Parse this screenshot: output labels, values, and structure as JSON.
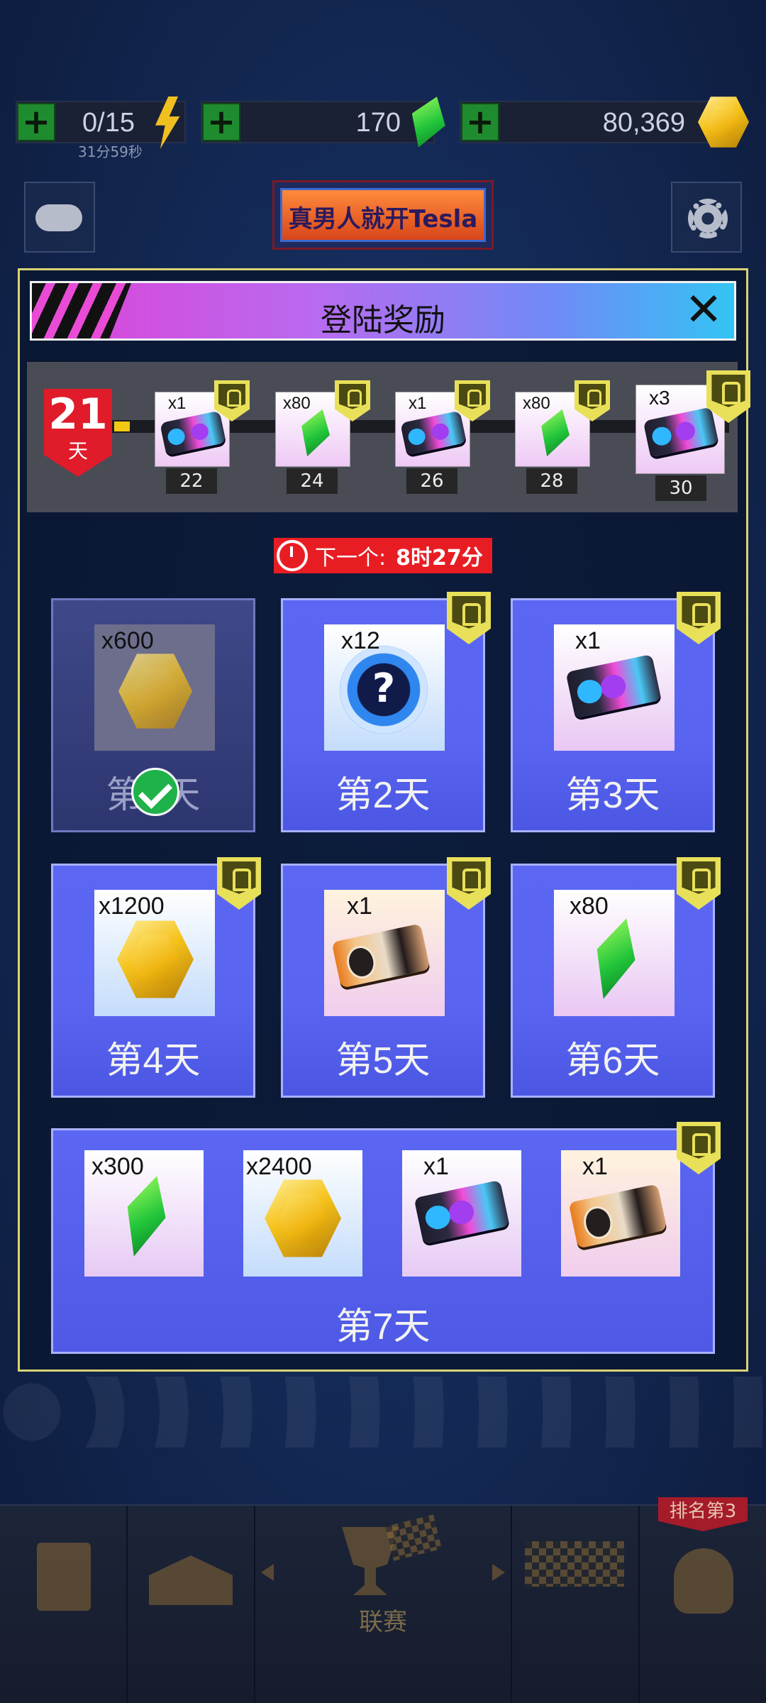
{
  "resources": {
    "energy": {
      "value": "0/15",
      "timer": "31分59秒"
    },
    "crystals": {
      "value": "170"
    },
    "coins": {
      "value": "80,369"
    }
  },
  "header": {
    "banner_text": "真男人就开Tesla"
  },
  "modal": {
    "title": "登陆奖励",
    "streak": {
      "days": "21",
      "unit": "天"
    },
    "milestones": [
      {
        "qty": "x1",
        "item": "ticket",
        "day": "22"
      },
      {
        "qty": "x80",
        "item": "crystal",
        "day": "24"
      },
      {
        "qty": "x1",
        "item": "ticket",
        "day": "26"
      },
      {
        "qty": "x80",
        "item": "crystal",
        "day": "28"
      },
      {
        "qty": "x3",
        "item": "ticket",
        "day": "30"
      }
    ],
    "next": {
      "label": "下一个:",
      "value": "8时27分"
    },
    "days": [
      {
        "label": "第1天",
        "qty": "x600",
        "item": "coin",
        "claimed": true
      },
      {
        "label": "第2天",
        "qty": "x12",
        "item": "mystery"
      },
      {
        "label": "第3天",
        "qty": "x1",
        "item": "ticket"
      },
      {
        "label": "第4天",
        "qty": "x1200",
        "item": "coin"
      },
      {
        "label": "第5天",
        "qty": "x1",
        "item": "turbo-ticket"
      },
      {
        "label": "第6天",
        "qty": "x80",
        "item": "crystal"
      }
    ],
    "day7": {
      "label": "第7天",
      "items": [
        {
          "qty": "x300",
          "item": "crystal"
        },
        {
          "qty": "x2400",
          "item": "coin"
        },
        {
          "qty": "x1",
          "item": "ticket"
        },
        {
          "qty": "x1",
          "item": "turbo-ticket"
        }
      ]
    }
  },
  "nav": {
    "league_label": "联赛",
    "rank_label": "排名第3"
  },
  "colors": {
    "accent_blue": "#5b67f2",
    "title_pink": "#d54bdc",
    "title_cyan": "#33c4f3",
    "lock_yellow": "#e9e05a",
    "timer_red": "#e81d23"
  }
}
